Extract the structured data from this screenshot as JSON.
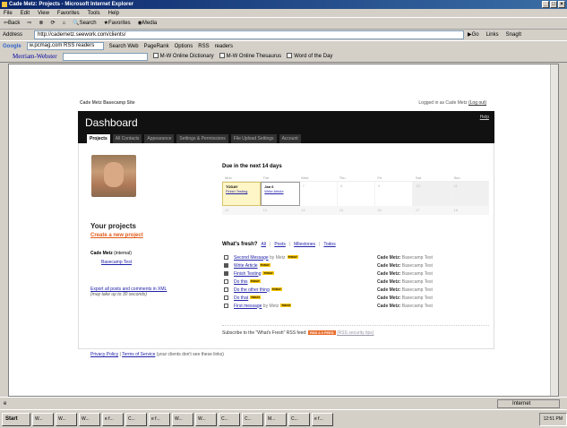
{
  "window": {
    "title": "Cade Metz: Projects - Microsoft Internet Explorer"
  },
  "menu": [
    "File",
    "Edit",
    "View",
    "Favorites",
    "Tools",
    "Help"
  ],
  "toolbar": [
    "Back",
    "Search",
    "Favorites",
    "Media"
  ],
  "address": {
    "label": "Address",
    "url": "http://cademetz.seework.com/clients/",
    "go": "Go",
    "links": "Links",
    "snagit": "SnagIt"
  },
  "google": {
    "logo": "Google",
    "query": "w.pcmag.com RSS readers",
    "search": "Search Web",
    "pagerank": "PageRank",
    "options": "Options",
    "rss": "RSS",
    "readers": "readers"
  },
  "mw": {
    "brand": "Merriam-Webster",
    "dict": "M-W Online Dictionary",
    "thes": "M-W Online Thesaurus",
    "wotd": "Word of the Day"
  },
  "page": {
    "site_name": "Cade Metz Basecamp Site",
    "login_prefix": "Logged in as Cade Metz",
    "logout": "(Log out)",
    "title": "Dashboard",
    "help": "Help",
    "tabs": [
      "Projects",
      "All Contacts",
      "Appearance",
      "Settings & Permissions",
      "File Upload Settings",
      "Account"
    ],
    "your_projects": "Your projects",
    "create": "Create a new project",
    "company": "Cade Metz",
    "company_note": "(internal)",
    "project": "Basecamp Test",
    "export_link": "Export all posts and comments in XML",
    "export_note": "(may take up to 30 seconds)",
    "due_title": "Due in the next 14 days",
    "cal_days": [
      "Mon",
      "Tue",
      "Wed",
      "Thu",
      "Fri",
      "Sat",
      "Sun"
    ],
    "cal_row1": {
      "today_label": "TODAY",
      "today_item": "Finish Testing",
      "d2": "Jan 6",
      "d2_item": "Write Article",
      "d3": "7",
      "d4": "8",
      "d5": "9",
      "d6": "10",
      "d7": "11"
    },
    "cal_row2": [
      "12",
      "13",
      "14",
      "15",
      "16",
      "17",
      "18"
    ],
    "wf_title": "What's fresh?",
    "wf_filters": {
      "all": "All",
      "posts": "Posts",
      "milestones": "Milestones",
      "todos": "Todos"
    },
    "wf_items": [
      {
        "title": "Second Message",
        "by": "by Metz",
        "project": "Cade Metz:",
        "pname": "Basecamp Test"
      },
      {
        "title": "Write Article",
        "by": "",
        "project": "Cade Metz:",
        "pname": "Basecamp Test"
      },
      {
        "title": "Finish Testing",
        "by": "",
        "project": "Cade Metz:",
        "pname": "Basecamp Test"
      },
      {
        "title": "Do this",
        "by": "",
        "project": "Cade Metz:",
        "pname": "Basecamp Test"
      },
      {
        "title": "Do the other thing",
        "by": "",
        "project": "Cade Metz:",
        "pname": "Basecamp Test"
      },
      {
        "title": "Do that",
        "by": "",
        "project": "Cade Metz:",
        "pname": "Basecamp Test"
      },
      {
        "title": "First message",
        "by": "by Metz",
        "project": "Cade Metz:",
        "pname": "Basecamp Test"
      }
    ],
    "badge": "TODAY",
    "rss_text": "Subscribe to the \"What's Fresh\" RSS feed:",
    "rss_badge": "RSS 2.0 FEED",
    "rss_link": "(RSS security tips)",
    "footer_privacy": "Privacy Policy",
    "footer_terms": "Terms of Service",
    "footer_note": "(your clients don't see these links)"
  },
  "status": {
    "zone": "Internet"
  },
  "taskbar": {
    "start": "Start",
    "time": "12:51 PM",
    "items": [
      "W...",
      "W...",
      "W...",
      "e f...",
      "C...",
      "e f...",
      "W...",
      "W...",
      "C...",
      "C...",
      "M...",
      "C...",
      "e f..."
    ]
  }
}
